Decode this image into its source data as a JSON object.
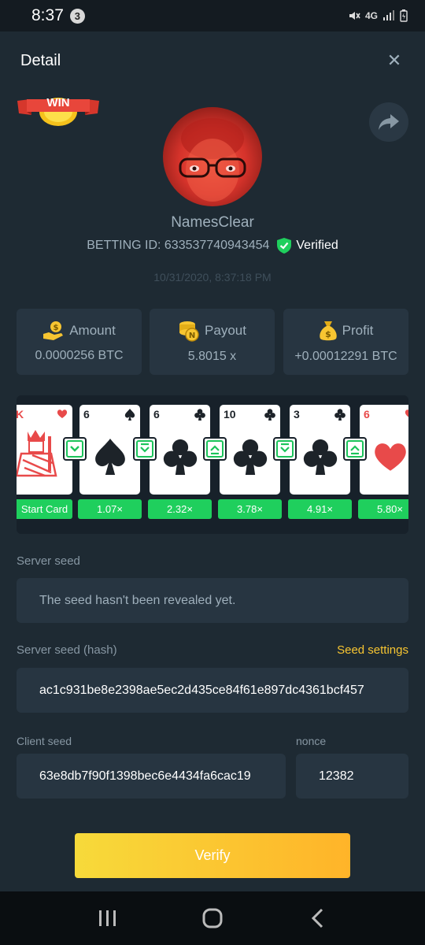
{
  "status_bar": {
    "time": "8:37",
    "notification_count": "3",
    "network": "4G"
  },
  "header": {
    "title": "Detail",
    "close_label": "✕"
  },
  "badge": {
    "label": "WIN"
  },
  "user": {
    "name": "NamesClear",
    "betting_id": "BETTING ID: 633537740943454",
    "verified_label": "Verified",
    "timestamp": "10/31/2020, 8:37:18 PM"
  },
  "stats": {
    "amount": {
      "label": "Amount",
      "value": "0.0000256 BTC",
      "icon": "dollar-hand-icon"
    },
    "payout": {
      "label": "Payout",
      "value": "5.8015 x",
      "icon": "coins-icon"
    },
    "profit": {
      "label": "Profit",
      "value": "+0.00012291 BTC",
      "icon": "money-bag-icon"
    }
  },
  "cards": [
    {
      "rank": "K",
      "suit": "heart",
      "color": "red"
    },
    {
      "rank": "6",
      "suit": "spade",
      "color": "black"
    },
    {
      "rank": "6",
      "suit": "club",
      "color": "black"
    },
    {
      "rank": "10",
      "suit": "club",
      "color": "black"
    },
    {
      "rank": "3",
      "suit": "club",
      "color": "black"
    },
    {
      "rank": "6",
      "suit": "heart",
      "color": "red"
    }
  ],
  "arrows": [
    "down",
    "down-double",
    "up-double",
    "down-double",
    "up-double"
  ],
  "multipliers": [
    "Start Card",
    "1.07×",
    "2.32×",
    "3.78×",
    "4.91×",
    "5.80×"
  ],
  "seeds": {
    "server_label": "Server seed",
    "server_value": "The seed hasn't been revealed yet.",
    "hash_label": "Server seed (hash)",
    "seed_settings": "Seed settings",
    "hash_value": "ac1c931be8e2398ae5ec2d435ce84f61e897dc4361bcf457",
    "client_label": "Client seed",
    "client_value": "63e8db7f90f1398bec6e4434fa6cac19",
    "nonce_label": "nonce",
    "nonce_value": "12382"
  },
  "verify_label": "Verify",
  "colors": {
    "accent_green": "#1fcf5d",
    "accent_yellow": "#f7c531",
    "panel": "#273541"
  }
}
